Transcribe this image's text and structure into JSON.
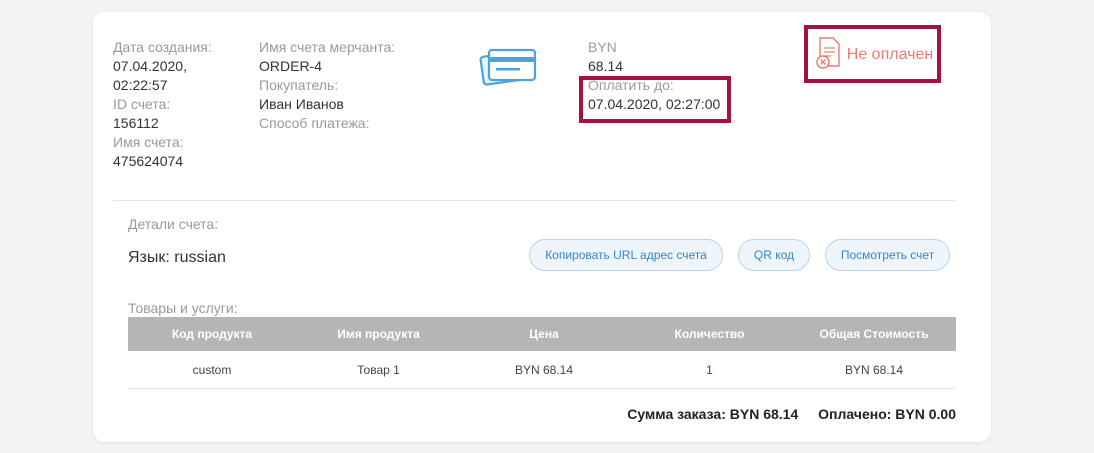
{
  "invoice": {
    "created_label": "Дата создания:",
    "created_value_line1": "07.04.2020,",
    "created_value_line2": "02:22:57",
    "id_label": "ID счета:",
    "id_value": "156112",
    "name_label": "Имя счета:",
    "name_value": "475624074",
    "merchant_name_label": "Имя счета мерчанта:",
    "merchant_name_value": "ORDER-4",
    "buyer_label": "Покупатель:",
    "buyer_value": "Иван Иванов",
    "payment_method_label": "Способ платежа:",
    "currency_label": "BYN",
    "amount_value": "68.14",
    "pay_until_label": "Оплатить до:",
    "pay_until_value": "07.04.2020, 02:27:00",
    "status_text": "Не оплачен",
    "details_label": "Детали счета:",
    "language_text": "Язык: russian",
    "goods_label": "Товары и услуги:"
  },
  "buttons": {
    "copy_url": "Копировать URL адрес счета",
    "qr_code": "QR код",
    "view_invoice": "Посмотреть счет"
  },
  "table": {
    "headers": [
      "Код продукта",
      "Имя продукта",
      "Цена",
      "Количество",
      "Общая Стоимость"
    ],
    "rows": [
      [
        "custom",
        "Товар 1",
        "BYN 68.14",
        "1",
        "BYN 68.14"
      ]
    ]
  },
  "totals": {
    "order_sum": "Сумма заказа: BYN 68.14",
    "paid": "Оплачено: BYN 0.00"
  },
  "colors": {
    "highlight": "#a3133f",
    "status": "#ec7a72",
    "accent": "#3b84c8",
    "table_header": "#b5b5b5"
  },
  "icons": {
    "card": "credit-card-icon",
    "status": "cancelled-document-icon"
  }
}
